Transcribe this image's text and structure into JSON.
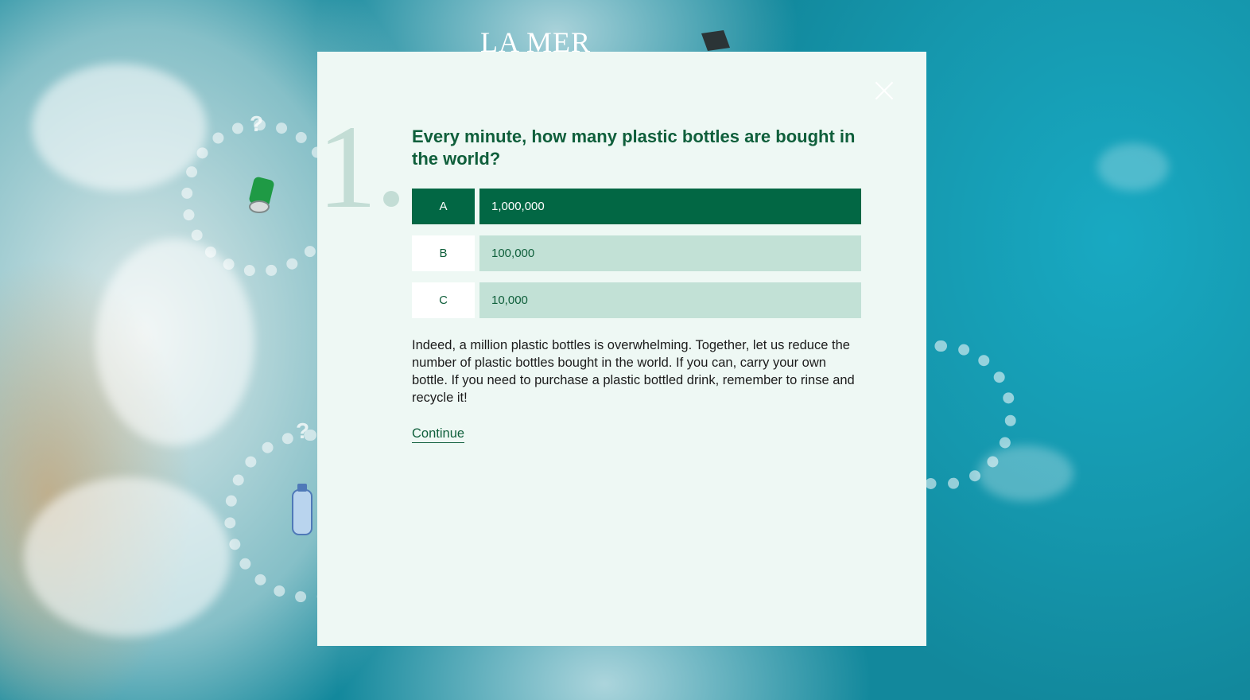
{
  "brand": {
    "logo_text": "LA MER"
  },
  "quiz": {
    "number": "1",
    "question": "Every minute, how many plastic bottles are bought in the world?",
    "answers": [
      {
        "letter": "A",
        "value": "1,000,000",
        "selected": true
      },
      {
        "letter": "B",
        "value": "100,000",
        "selected": false
      },
      {
        "letter": "C",
        "value": "10,000",
        "selected": false
      }
    ],
    "feedback": "Indeed, a million plastic bottles is overwhelming. Together, let us reduce the number of plastic bottles bought in the world. If you can, carry your own bottle. If you need to purchase a plastic bottled drink, remember to rinse and recycle it!",
    "continue_label": "Continue"
  },
  "background": {
    "marker_symbol": "?",
    "colors": {
      "accent": "#026744",
      "option": "#c2e1d6",
      "panel": "#eef8f4",
      "number": "#c3ddd5"
    }
  }
}
